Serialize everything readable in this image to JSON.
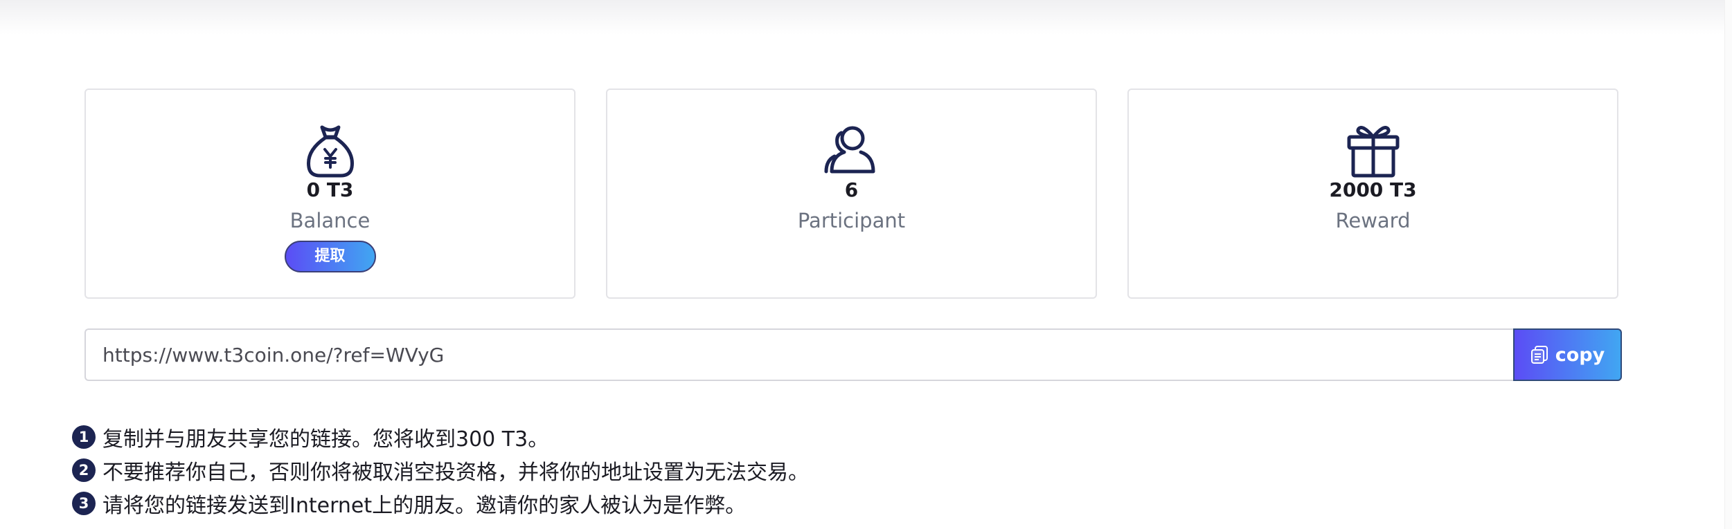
{
  "cards": [
    {
      "icon": "money-bag-yen-icon",
      "value": "0 T3",
      "label": "Balance",
      "button_label": "提取"
    },
    {
      "icon": "user-outline-icon",
      "value": "6",
      "label": "Participant"
    },
    {
      "icon": "gift-icon",
      "value": "2000 T3",
      "label": "Reward"
    }
  ],
  "referral": {
    "link": "https://www.t3coin.one/?ref=WVyG",
    "copy_label": "copy",
    "copy_icon": "copy-icon"
  },
  "rules": [
    {
      "num": "1",
      "text": "复制并与朋友共享您的链接。您将收到300 T3。"
    },
    {
      "num": "2",
      "text": "不要推荐你自己，否则你将被取消空投资格，并将你的地址设置为无法交易。"
    },
    {
      "num": "3",
      "text": "请将您的链接发送到Internet上的朋友。邀请你的家人被认为是作弊。"
    }
  ],
  "colors": {
    "icon": "#1c2452",
    "gradient_start": "#5b4df5",
    "gradient_end": "#41a6f2",
    "label": "#6b7280"
  }
}
